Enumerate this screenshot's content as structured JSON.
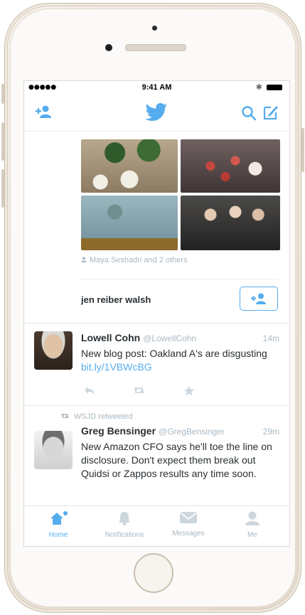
{
  "status": {
    "signal": "●●●●● ",
    "time": "9:41 AM",
    "bluetooth": "✱"
  },
  "nav": {
    "add_user_icon": "add-user-icon",
    "logo_icon": "twitter-bird-icon",
    "search_icon": "search-icon",
    "compose_icon": "compose-icon"
  },
  "photo_tweet": {
    "tagged": "Maya Seshadri and 2 others"
  },
  "suggestion": {
    "name": "jen reiber walsh"
  },
  "tweets": [
    {
      "name": "Lowell Cohn",
      "handle": "@LowellCohn",
      "time": "14m",
      "text": "New blog post: Oakland A's are disgusting ",
      "link": "bit.ly/1VBWcBG"
    },
    {
      "retweeted_by": "WSJD retweeted",
      "name": "Greg Bensinger",
      "handle": "@GregBensinger",
      "time": "29m",
      "text": "New Amazon CFO says he'll toe the line on disclosure. Don't expect them break out Quidsi or Zappos results any time soon."
    }
  ],
  "tabs": [
    {
      "label": "Home",
      "icon": "home-icon",
      "active": true
    },
    {
      "label": "Notifications",
      "icon": "bell-icon",
      "active": false
    },
    {
      "label": "Messages",
      "icon": "envelope-icon",
      "active": false
    },
    {
      "label": "Me",
      "icon": "person-icon",
      "active": false
    }
  ],
  "colors": {
    "accent": "#55acee",
    "muted": "#aab8c2",
    "text": "#292f33"
  }
}
